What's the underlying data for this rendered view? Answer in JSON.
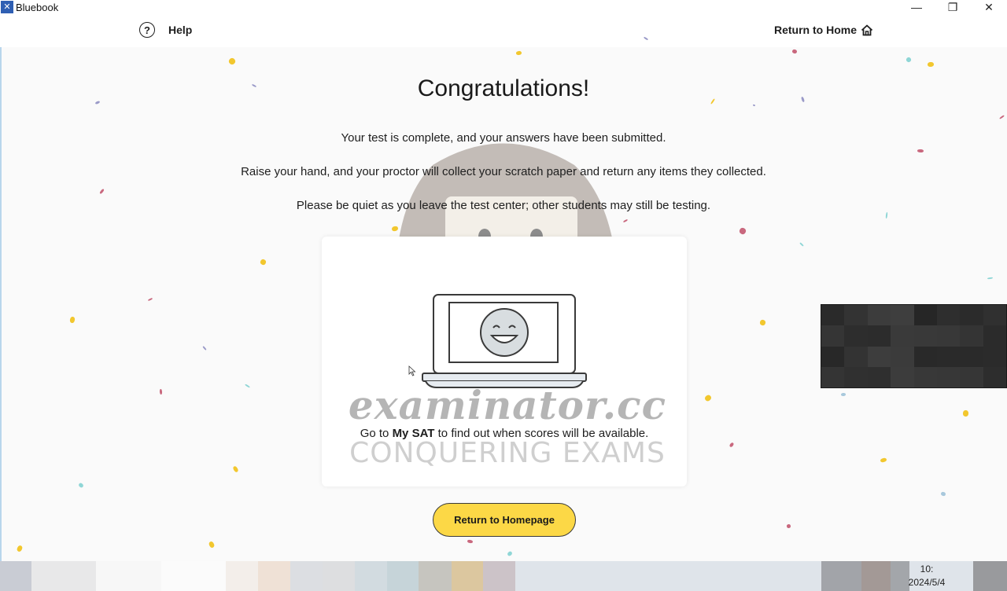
{
  "window": {
    "app_title": "Bluebook",
    "logo_icon": "bluebook-logo-icon",
    "controls": {
      "minimize": "—",
      "maximize": "❐",
      "close": "✕"
    }
  },
  "header": {
    "help_label": "Help",
    "help_icon_glyph": "?",
    "return_home_label": "Return to Home"
  },
  "main": {
    "title": "Congratulations!",
    "messages": [
      "Your test is complete, and your answers have been submitted.",
      "Raise your hand, and your proctor will collect your scratch paper and return any items they collected.",
      "Please be quiet as you leave the test center; other students may still be testing."
    ],
    "card": {
      "text_before": "Go to ",
      "text_bold": "My SAT",
      "text_after": " to find out when scores will be available."
    },
    "primary_button_label": "Return to Homepage"
  },
  "watermark": {
    "line1": "examinator.cc",
    "line2": "CONQUERING EXAMS"
  },
  "taskbar": {
    "clock_time": "10:",
    "clock_date": "2024/5/4"
  },
  "colors": {
    "accent_button": "#fcd846",
    "background": "#fafafa",
    "confetti": [
      "#f2c72e",
      "#c9687e",
      "#8fd6d6",
      "#9a9ac8",
      "#a8c8dc"
    ]
  }
}
